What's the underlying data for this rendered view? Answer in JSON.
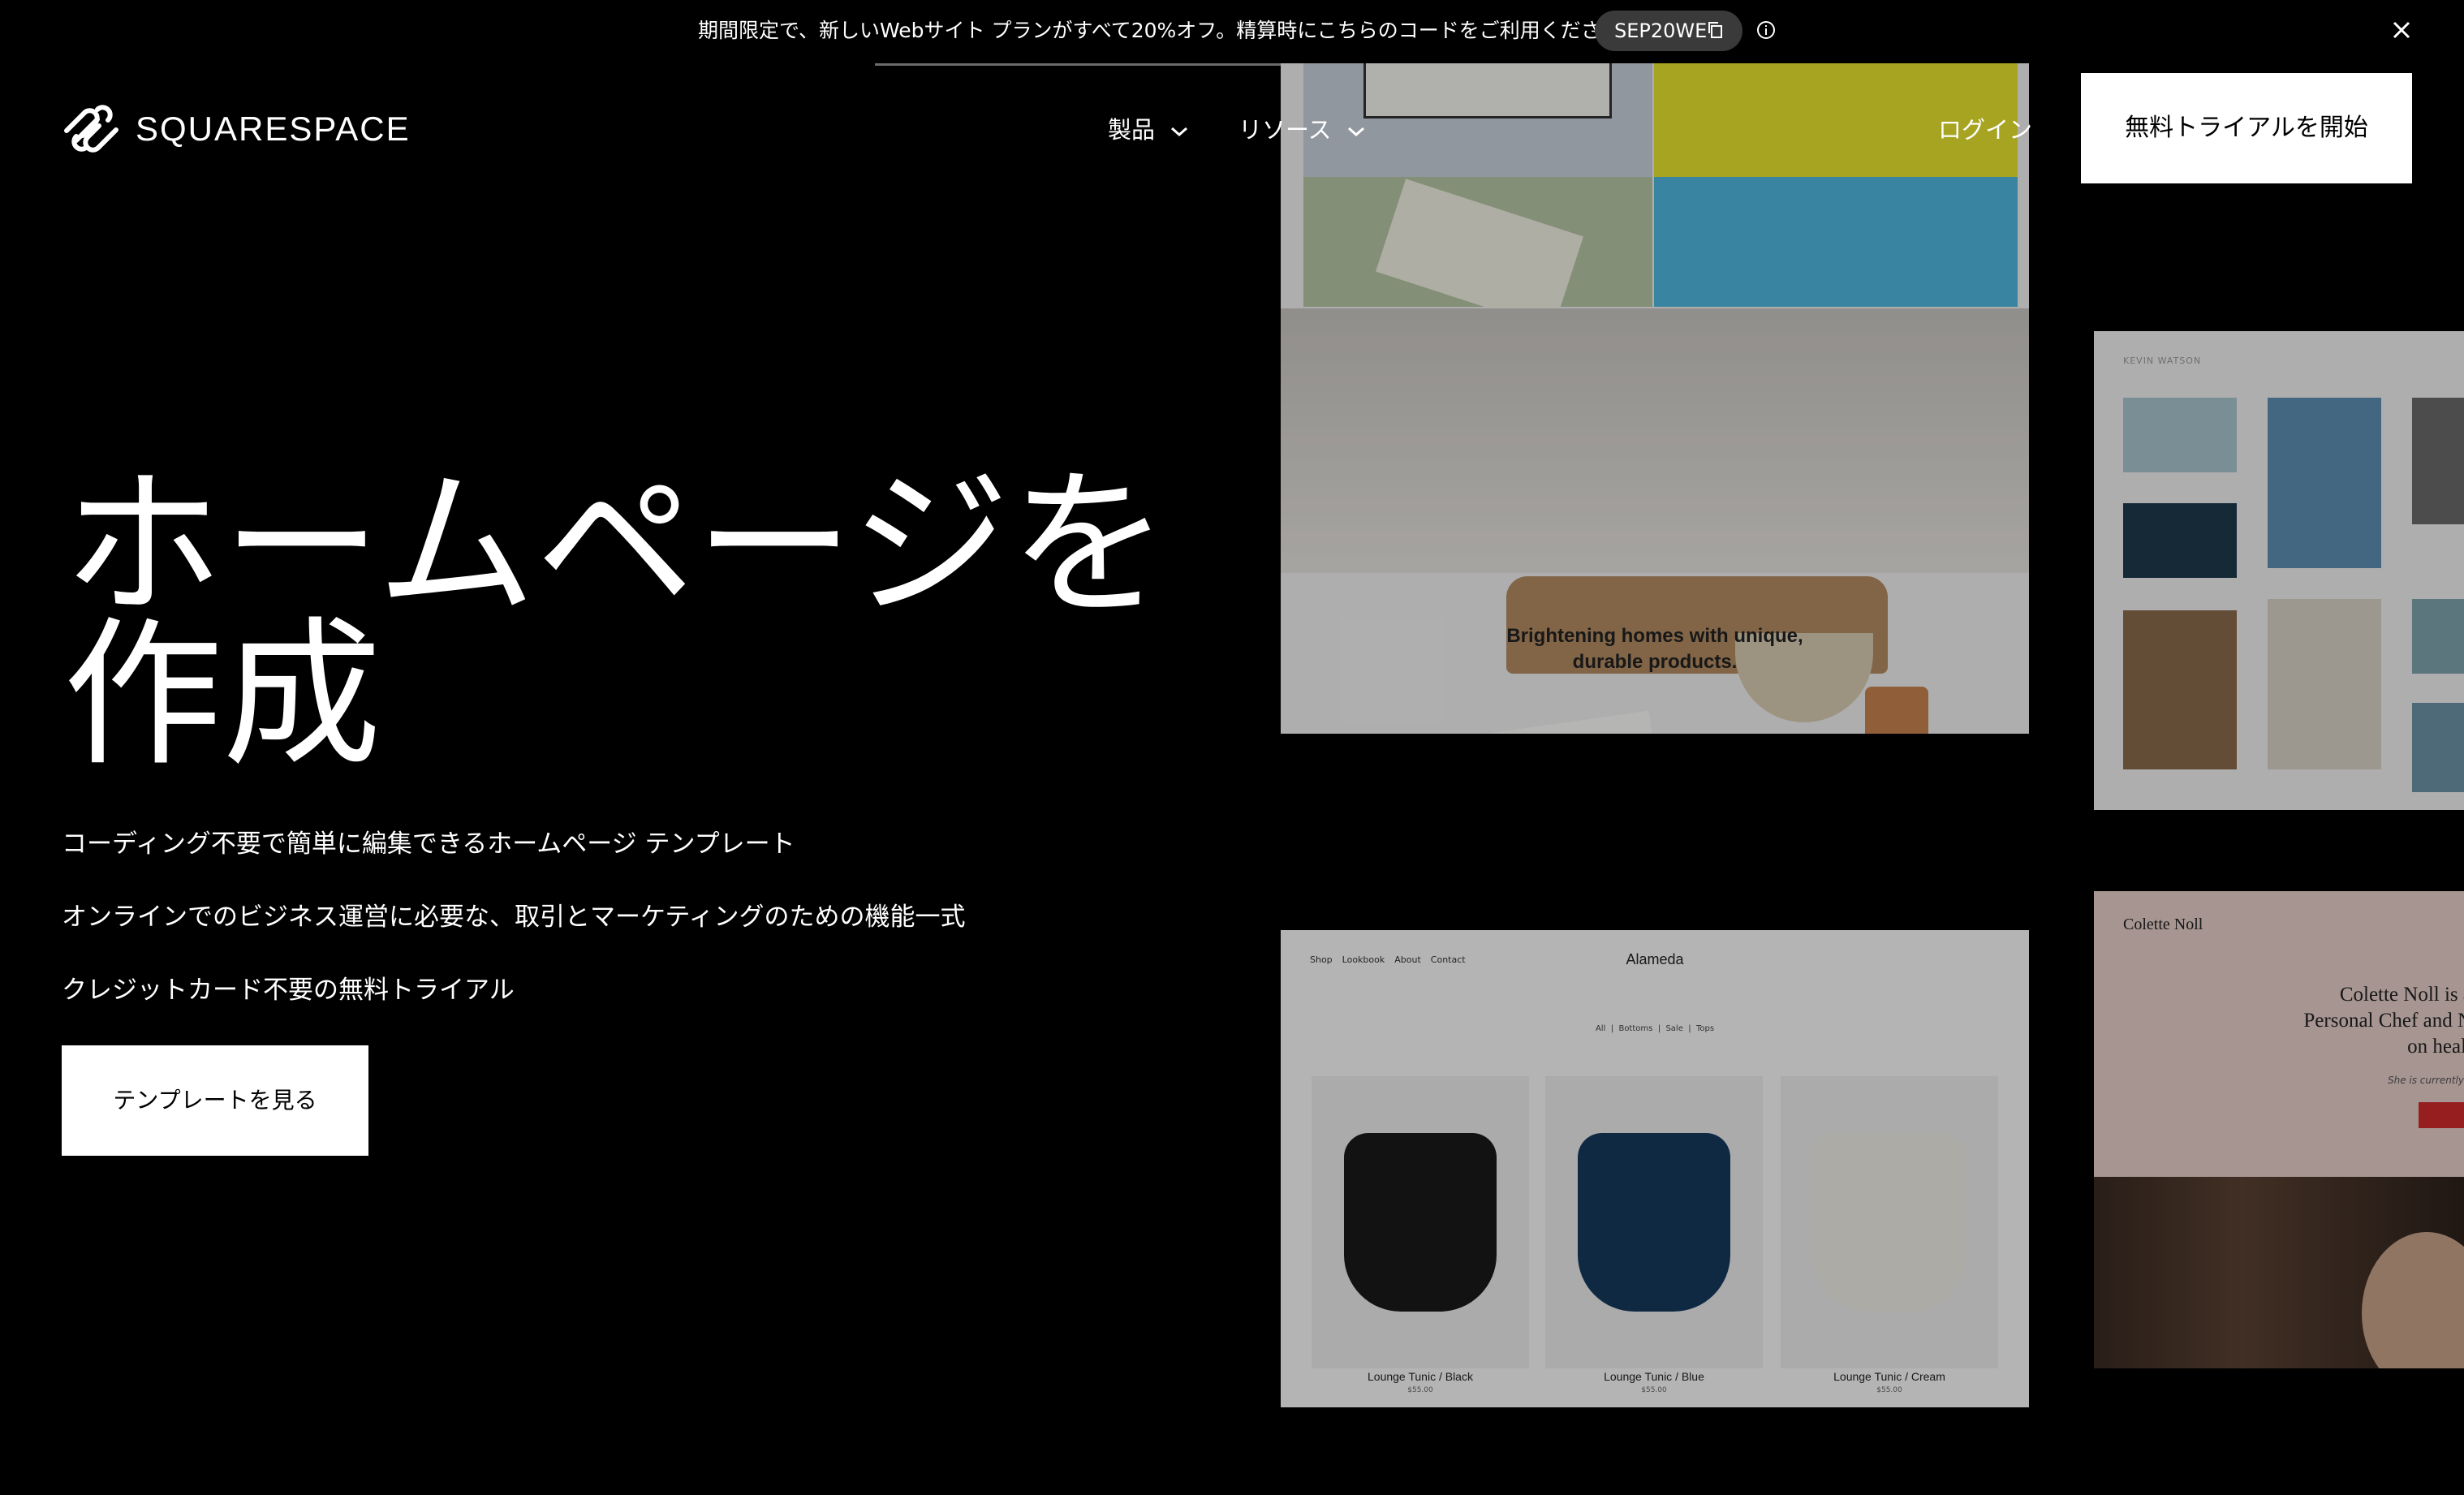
{
  "banner": {
    "text": "期間限定で、新しいWebサイト プランがすべて20%オフ。精算時にこちらのコードをご利用ください:",
    "promo_code": "SEP20WE",
    "copy_icon": "copy-icon",
    "info_icon": "info-icon",
    "close_icon": "close-icon"
  },
  "header": {
    "logo_text": "SQUARESPACE",
    "nav": [
      {
        "label": "製品",
        "icon": "chevron-down-icon"
      },
      {
        "label": "リソース",
        "icon": "chevron-down-icon"
      }
    ],
    "login": "ログイン",
    "trial_button": "無料トライアルを開始"
  },
  "hero": {
    "title_line1": "ホームページを",
    "title_line2": "作成",
    "features": [
      "コーディング不要で簡単に編集できるホームページ テンプレート",
      "オンラインでのビジネス運営に必要な、取引とマーケティングのための機能一式",
      "クレジットカード不要の無料トライアル"
    ],
    "cta": "テンプレートを見る"
  },
  "templates": {
    "card1": {
      "caption_line1": "Brightening homes with unique,",
      "caption_line2": "durable products."
    },
    "card2": {
      "name": "KEVIN WATSON"
    },
    "card3": {
      "nav": [
        "Shop",
        "Lookbook",
        "About",
        "Contact"
      ],
      "brand": "Alameda",
      "categories": [
        "All",
        "Bottoms",
        "Sale",
        "Tops"
      ],
      "products": [
        {
          "name": "Lounge Tunic / Black",
          "price": "$55.00"
        },
        {
          "name": "Lounge Tunic / Blue",
          "price": "$55.00"
        },
        {
          "name": "Lounge Tunic / Cream",
          "price": "$55.00"
        }
      ]
    },
    "card4": {
      "name": "Colette Noll",
      "headline_1": "Colette Noll is a",
      "headline_2": "Personal Chef and N",
      "headline_3": "on healt",
      "sub": "She is currently"
    }
  },
  "colors": {
    "background": "#000000",
    "button_bg": "#ffffff",
    "promo_pill": "#3a3a3a"
  }
}
